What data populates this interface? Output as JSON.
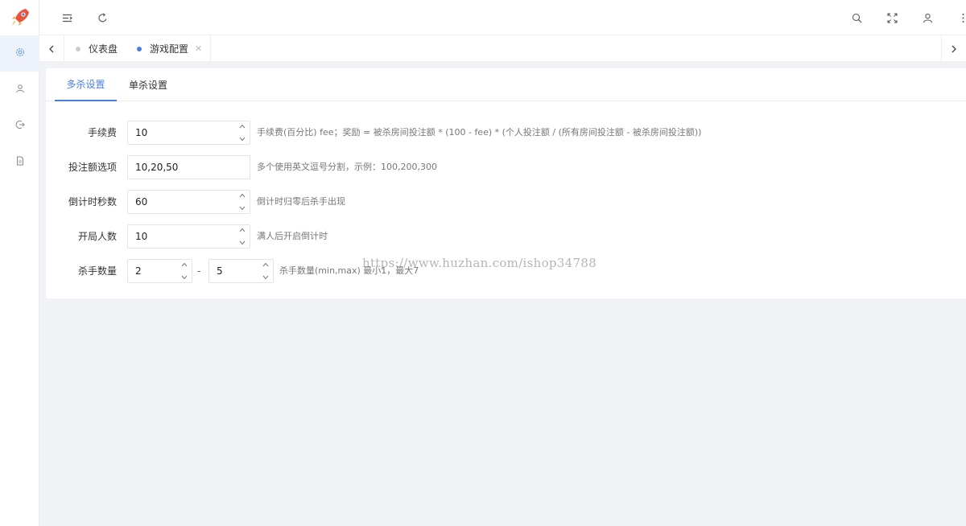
{
  "topbar": {
    "icons": [
      "menu-fold-icon",
      "refresh-icon",
      "search-icon",
      "fullscreen-icon",
      "user-icon",
      "more-icon"
    ]
  },
  "sidebar": {
    "items": [
      {
        "icon": "settings-icon",
        "active": true
      },
      {
        "icon": "user-icon",
        "active": false
      },
      {
        "icon": "logout-icon",
        "active": false
      },
      {
        "icon": "document-icon",
        "active": false
      }
    ]
  },
  "tabs": [
    {
      "label": "仪表盘",
      "active": false
    },
    {
      "label": "游戏配置",
      "active": true
    }
  ],
  "subtabs": [
    {
      "label": "多杀设置",
      "active": true
    },
    {
      "label": "单杀设置",
      "active": false
    }
  ],
  "form": {
    "fee": {
      "label": "手续费",
      "value": "10",
      "hint": "手续费(百分比) fee；奖励 = 被杀房间投注额 * (100 - fee) * (个人投注额 / (所有房间投注额 - 被杀房间投注额))"
    },
    "bet_options": {
      "label": "投注额选项",
      "value": "10,20,50",
      "hint": "多个使用英文逗号分割，示例：100,200,300"
    },
    "countdown": {
      "label": "倒计时秒数",
      "value": "60",
      "hint": "倒计时归零后杀手出现"
    },
    "players": {
      "label": "开局人数",
      "value": "10",
      "hint": "满人后开启倒计时"
    },
    "killers": {
      "label": "杀手数量",
      "min": "2",
      "max": "5",
      "separator": "-",
      "hint": "杀手数量(min,max) 最小1，最大7"
    }
  },
  "watermark": "https://www.huzhan.com/ishop34788",
  "colors": {
    "accent": "#4a7fe0"
  }
}
